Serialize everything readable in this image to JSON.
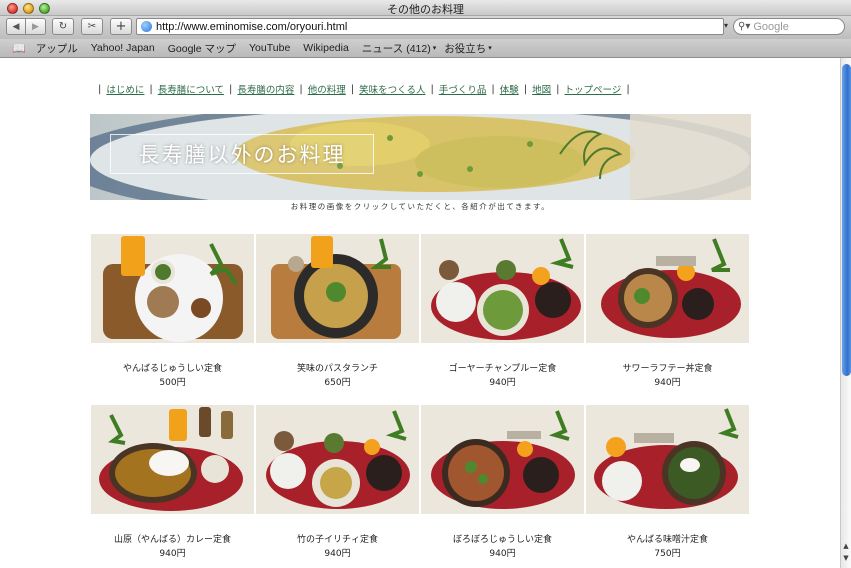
{
  "window": {
    "title": "その他のお料理",
    "address": "http://www.eminomise.com/oryouri.html",
    "search_placeholder": "Google"
  },
  "bookmarks": [
    "アップル",
    "Yahoo! Japan",
    "Google マップ",
    "YouTube",
    "Wikipedia",
    "ニュース (412)",
    "お役立ち"
  ],
  "site_nav": [
    "はじめに",
    "長寿膳について",
    "長寿膳の内容",
    "他の料理",
    "笑味をつくる人",
    "手づくり品",
    "体験",
    "地図",
    "トップページ"
  ],
  "banner": {
    "title": "長寿膳以外のお料理"
  },
  "hint": "お料理の画像をクリックしていただくと、各紹介が出てきます。",
  "dishes": [
    {
      "name": "やんばるじゅうしい定食",
      "price": "500円"
    },
    {
      "name": "笑味のパスタランチ",
      "price": "650円"
    },
    {
      "name": "ゴーヤーチャンプルー定食",
      "price": "940円"
    },
    {
      "name": "サワーラフテー丼定食",
      "price": "940円"
    },
    {
      "name": "山原（やんばる）カレー定食",
      "price": "940円"
    },
    {
      "name": "竹の子イリチィ定食",
      "price": "940円"
    },
    {
      "name": "ぼろぼろじゅうしい定食",
      "price": "940円"
    },
    {
      "name": "やんばる味噌汁定食",
      "price": "750円"
    }
  ],
  "colors": {
    "nav_link": "#2e6b48",
    "tray_red": "#a8202a",
    "tray_wood": "#8a5a2b"
  }
}
